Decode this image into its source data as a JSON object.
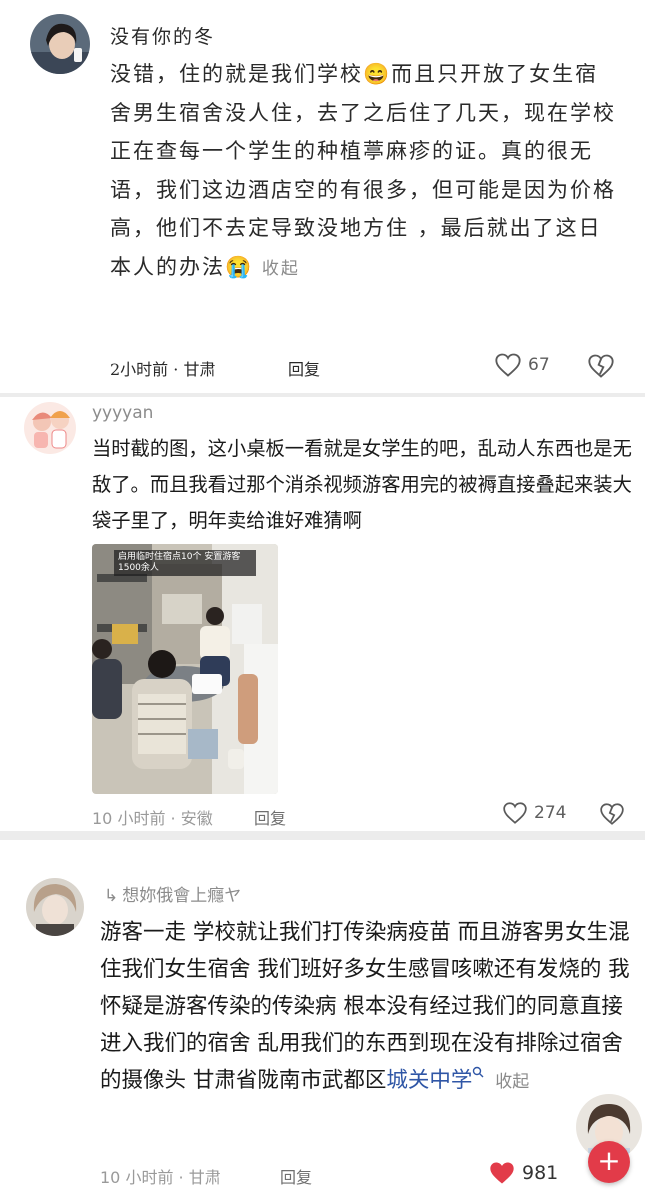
{
  "comments": [
    {
      "username": "没有你的冬",
      "text": "没错，住的就是我们学校",
      "text_after_emoji": "而且只开放了女生宿舍男生宿舍没人住，去了之后住了几天，现在学校正在查每一个学生的种植葶麻疹的证。真的很无语，我们这边酒店空的有很多，但可能是因为价格高，他们不去定导致没地方住 ，最后就出了这日本人的办法",
      "emoji_1": "😄",
      "emoji_2": "😭",
      "fold_label": "收起",
      "meta": "2小时前 · 甘肃",
      "reply_label": "回复",
      "likes": "67",
      "liked": false
    },
    {
      "username": "yyyyan",
      "text": "当时截的图，这小桌板一看就是女学生的吧，乱动人东西也是无敌了。而且我看过那个消杀视频游客用完的被褥直接叠起来装大袋子里了，明年卖给谁好难猜啊",
      "image_banner": "启用临时住宿点10个 安置游客1500余人",
      "meta": "10 小时前 · 安徽",
      "reply_label": "回复",
      "likes": "274",
      "liked": false
    },
    {
      "username": "想妳俄會上癮ヤ",
      "reply_prefix": "↳",
      "text": "游客一走 学校就让我们打传染病疫苗 而且游客男女生混住我们女生宿舍 我们班好多女生感冒咳嗽还有发烧的 我怀疑是游客传染的传染病 根本没有经过我们的同意直接进入我们的宿舍 乱用我们的东西到现在没有排除过宿舍的摄像头 甘肃省陇南市武都区",
      "link_text": "城关中学",
      "fold_label": "收起",
      "meta": "10 小时前 · 甘肃",
      "reply_label": "回复",
      "likes": "981",
      "liked": true
    }
  ],
  "fab": {
    "icon": "plus-icon"
  },
  "colors": {
    "liked": "#e23b49",
    "link": "#2f56a6",
    "meta": "#9a9a9a",
    "separator": "#ececec"
  }
}
